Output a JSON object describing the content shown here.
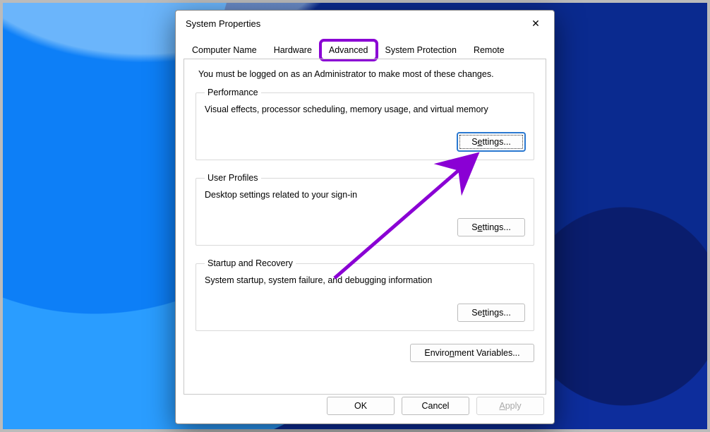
{
  "window": {
    "title": "System Properties",
    "close_glyph": "✕"
  },
  "tabs": {
    "computer_name": "Computer Name",
    "hardware": "Hardware",
    "advanced": "Advanced",
    "system_protection": "System Protection",
    "remote": "Remote"
  },
  "advanced_panel": {
    "admin_note": "You must be logged on as an Administrator to make most of these changes.",
    "performance": {
      "legend": "Performance",
      "desc": "Visual effects, processor scheduling, memory usage, and virtual memory",
      "button": "Settings..."
    },
    "user_profiles": {
      "legend": "User Profiles",
      "desc": "Desktop settings related to your sign-in",
      "button": "Settings..."
    },
    "startup": {
      "legend": "Startup and Recovery",
      "desc": "System startup, system failure, and debugging information",
      "button": "Settings..."
    },
    "env_button": "Environment Variables..."
  },
  "buttons": {
    "ok": "OK",
    "cancel": "Cancel",
    "apply": "Apply"
  },
  "annotation": {
    "arrow_color": "#8a00d4"
  }
}
